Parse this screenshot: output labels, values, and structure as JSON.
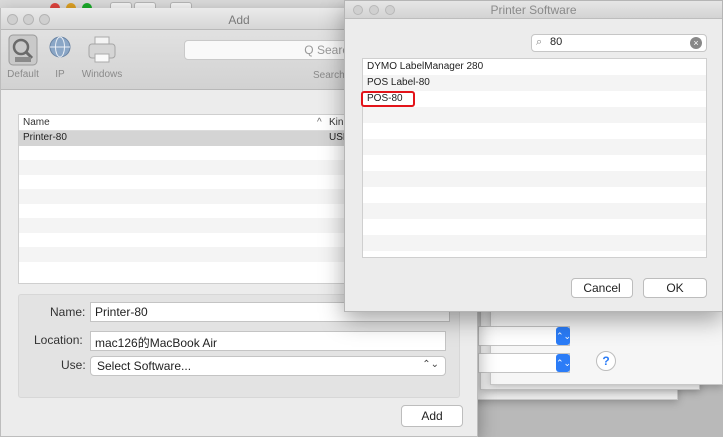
{
  "add_window": {
    "title": "Add",
    "toolbar": {
      "default_label": "Default",
      "ip_label": "IP",
      "windows_label": "Windows",
      "search_placeholder": "Q Search",
      "search_caption": "Search"
    },
    "list": {
      "columns": {
        "name": "Name",
        "kind": "Kin"
      },
      "sort_indicator": "^",
      "rows": [
        {
          "name": "Printer-80",
          "kind": "USB",
          "selected": true
        }
      ]
    },
    "details": {
      "name_label": "Name:",
      "name_value": "Printer-80",
      "location_label": "Location:",
      "location_value": "mac126的MacBook Air",
      "use_label": "Use:",
      "use_value": "Select Software...",
      "use_arrows": "⌃⌄"
    },
    "add_button": "Add"
  },
  "printer_software": {
    "title": "Printer Software",
    "search_value": "80",
    "items": [
      "DYMO LabelManager 280",
      "POS Label-80",
      "POS-80"
    ],
    "cancel_button": "Cancel",
    "ok_button": "OK"
  },
  "background": {
    "help_button": "?",
    "stepper_glyph": "⌃⌄"
  },
  "colors": {
    "accent_blue": "#2b7cf7",
    "highlight_red": "#e3141a"
  }
}
